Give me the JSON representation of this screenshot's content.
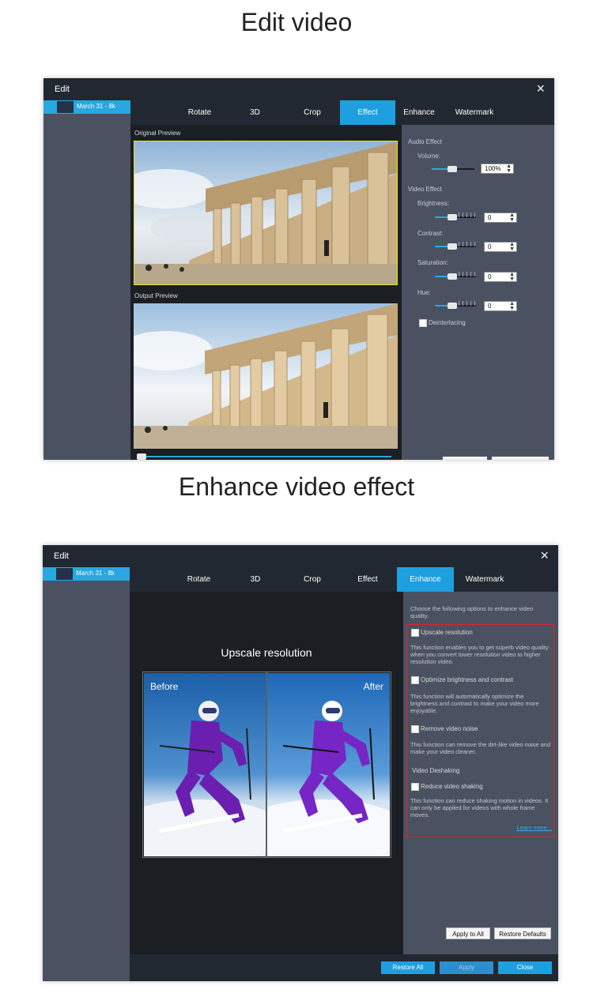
{
  "captions": {
    "top": "Edit video",
    "middle": "Enhance video effect"
  },
  "window1": {
    "title": "Edit",
    "close_icon": "×",
    "file_name": "March 31 - 8k",
    "tabs": [
      "Rotate",
      "3D",
      "Crop",
      "Effect",
      "Enhance",
      "Watermark"
    ],
    "active_tab": "Effect",
    "original_preview_label": "Original Preview",
    "output_preview_label": "Output Preview",
    "audio_effect_label": "Audio Effect",
    "volume_label": "Volume:",
    "volume_value": "100%",
    "video_effect_label": "Video Effect",
    "brightness_label": "Brightness:",
    "brightness_value": "0",
    "contrast_label": "Contrast:",
    "contrast_value": "0",
    "saturation_label": "Saturation:",
    "saturation_value": "0",
    "hue_label": "Hue:",
    "hue_value": "0",
    "deinterlacing_label": "Deinterlacing"
  },
  "window2": {
    "title": "Edit",
    "close_icon": "×",
    "file_name": "March 31 - 8k",
    "tabs": [
      "Rotate",
      "3D",
      "Crop",
      "Effect",
      "Enhance",
      "Watermark"
    ],
    "active_tab": "Enhance",
    "upscale_title": "Upscale resolution",
    "before_label": "Before",
    "after_label": "After",
    "intro": "Choose the following options to enhance video quality.",
    "options": [
      {
        "label": "Upscale resolution",
        "desc": "This function enables you to get superb video quality when you convert lower resolution video to higher resolution video."
      },
      {
        "label": "Optimize brightness and contrast",
        "desc": "This function will automatically optimize the brightness and contrast to make your video more enjoyable."
      },
      {
        "label": "Remove video noise",
        "desc": "This function can remove the dirt-like video noise and make your video cleaner."
      }
    ],
    "deshaking_heading": "Video Deshaking",
    "deshake_option": {
      "label": "Reduce video shaking",
      "desc": "This function can reduce shaking motion in videos. It can only be applied for videos with whole frame moves."
    },
    "learn_more": "Learn more...",
    "apply_to_all": "Apply to All",
    "restore_defaults": "Restore Defaults",
    "restore_all": "Restore All",
    "apply": "Apply",
    "close": "Close"
  },
  "colors": {
    "accent": "#1e9fe0",
    "highlight_border": "#d8262c",
    "preview_border": "#e6e21d"
  }
}
